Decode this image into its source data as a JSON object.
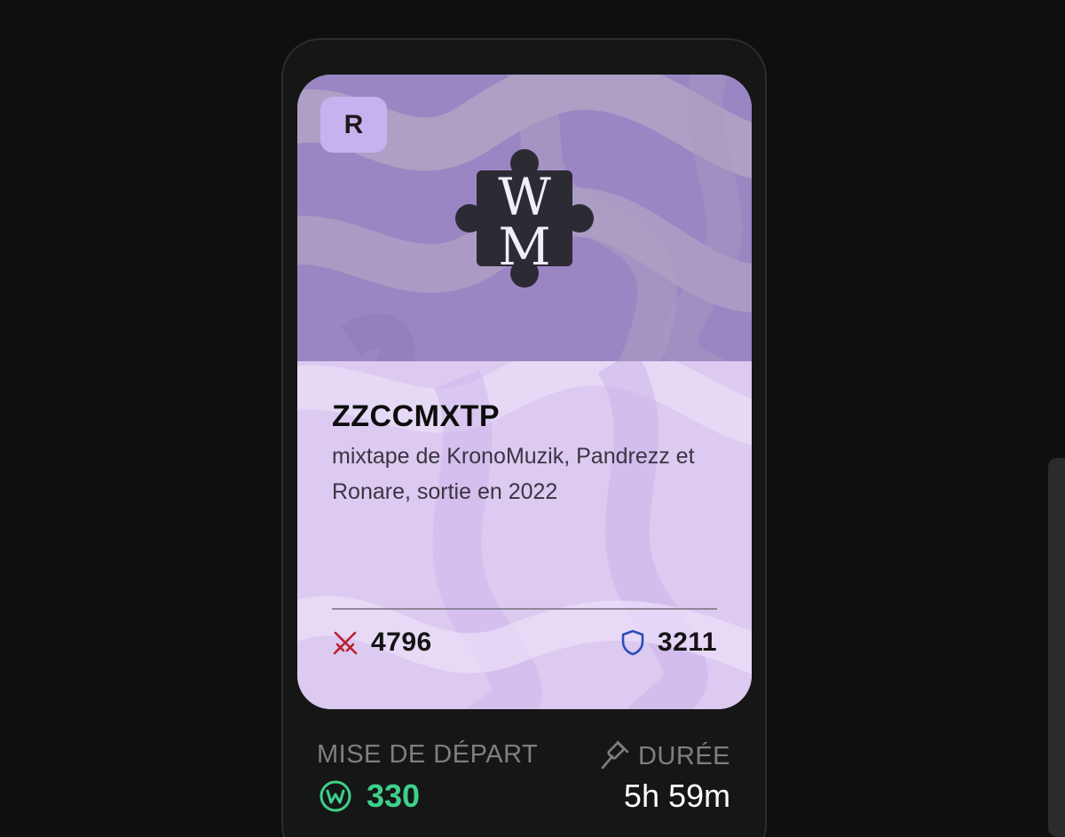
{
  "card": {
    "rarity": "R",
    "logo_text": "WM",
    "title": "ZZCCMXTP",
    "description": "mixtape de KronoMuzik, Pandrezz et Ronare, sortie en 2022",
    "attack": "4796",
    "defense": "3211"
  },
  "auction": {
    "starting_bid_label": "MISE DE DÉPART",
    "starting_bid_value": "330",
    "duration_label": "DURÉE",
    "duration_value": "5h 59m"
  },
  "icons": {
    "attack": "crossed-swords-icon",
    "defense": "shield-icon",
    "currency": "w-coin-icon",
    "auction": "gavel-icon"
  },
  "colors": {
    "page_background": "#0f0f0f",
    "card_top": "#9b86c4",
    "card_bottom": "#dccaf1",
    "rarity_badge": "#c7b2f0",
    "attack_icon": "#b8222e",
    "defense_icon": "#2b4fb8",
    "currency": "#3fd08b"
  }
}
